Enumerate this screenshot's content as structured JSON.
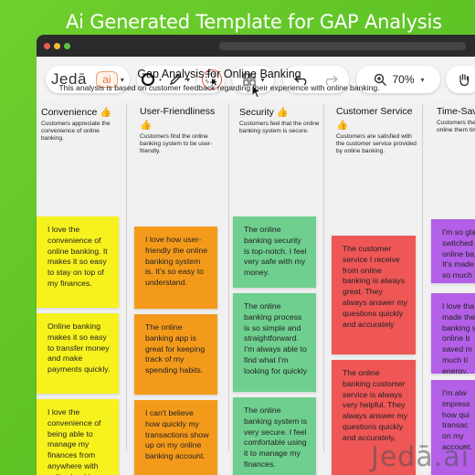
{
  "banner": {
    "title": "Ai Generated Template for GAP Analysis"
  },
  "toolbar": {
    "logo": "Jedā",
    "ai_label": "ai",
    "zoom": "70%"
  },
  "document": {
    "title": "Gap Analysis for Online Banking",
    "subtitle": "This analysis is based on customer feedback regarding their experience with online banking."
  },
  "columns": [
    {
      "header": "Convenience 👍",
      "desc": "Customers appreciate the convenience of online banking.",
      "color": "#f7f21e",
      "notes": [
        "I love the convenience of online banking. It makes it so easy to stay on top of my finances.",
        "Online banking makes it so easy to transfer money and make payments quickly.",
        "I love the convenience of being able to manage my finances from anywhere with online banking."
      ]
    },
    {
      "header": "User-Friendliness",
      "header2": "👍",
      "desc": "Customers find the online banking system to be user-friendly.",
      "color": "#f49a1a",
      "notes": [
        "I love how user-friendly the online banking system is. It's so easy to understand.",
        "The online banking app is great for keeping track of my spending habits.",
        "I can't believe how quickly my transactions show up on my online banking account."
      ]
    },
    {
      "header": "Security 👍",
      "desc": "Customers feel that the online banking system is secure.",
      "color": "#6fcf8f",
      "notes": [
        "The online banking security is top-notch. I feel very safe with my money.",
        "The online banking process is so simple and straightforward. I'm always able to find what I'm looking for quickly",
        "The online banking system is very secure. I feel comfortable using it to manage my finances."
      ]
    },
    {
      "header": "Customer Service",
      "header2": "👍",
      "desc": "Customers are satisfied with the customer service provided by online banking.",
      "color": "#ef5656",
      "notes": [
        "The customer service I receive from online banking is always great. They always answer my questions quickly and accurately",
        "The online banking customer service is always very helpful. They always answer my questions quickly and accurately."
      ]
    },
    {
      "header": "Time-Savi",
      "desc": "Customers the online them time.",
      "color": "#b45fe8",
      "notes": [
        "I'm so gla switched online ba It's made so much",
        "I love tha made the banking s online b saved m much ti energy.",
        "I'm alw impress how qui transac on my account."
      ]
    }
  ],
  "watermark": "Jedā.ai"
}
